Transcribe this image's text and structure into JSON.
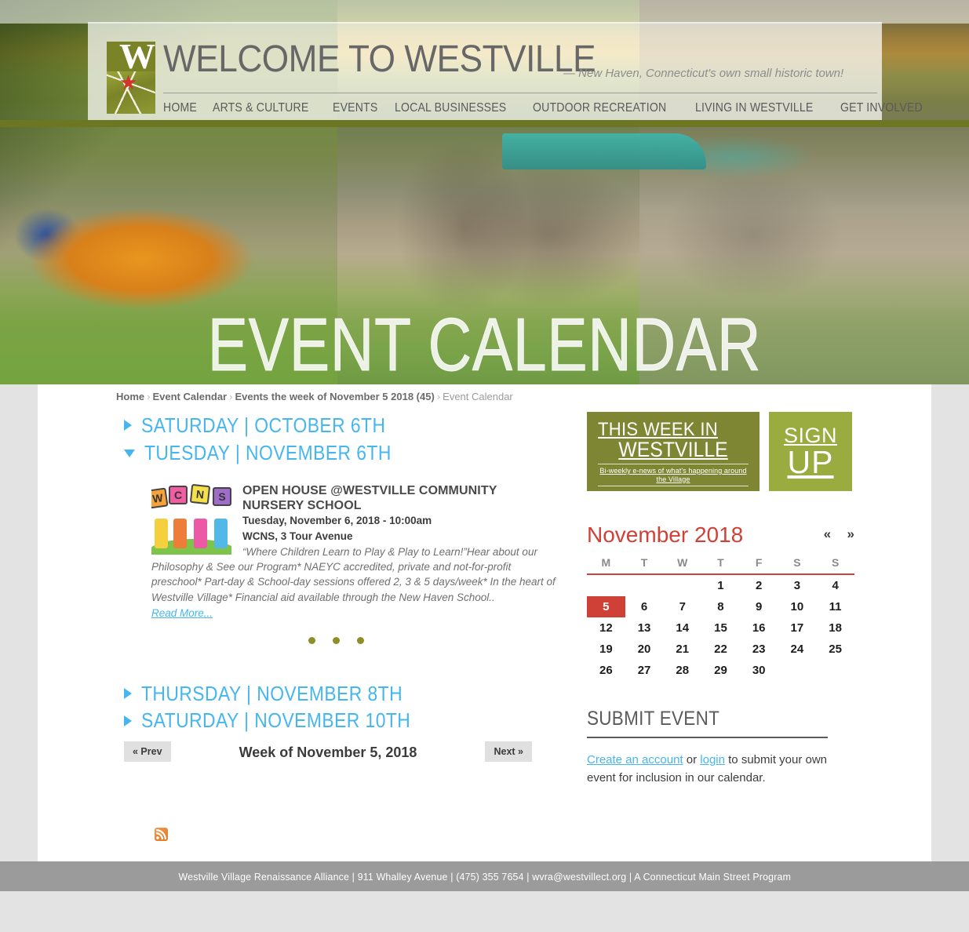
{
  "site": {
    "title": "WELCOME TO WESTVILLE",
    "tagline": "—  New Haven, Connecticut's own small historic town!",
    "logo_letter": "W"
  },
  "nav": {
    "items": [
      {
        "label": "HOME",
        "name": "home"
      },
      {
        "label": "ARTS & CULTURE",
        "name": "arts-culture"
      },
      {
        "label": "EVENTS",
        "name": "events"
      },
      {
        "label": "LOCAL BUSINESSES",
        "name": "local-businesses"
      },
      {
        "label": "OUTDOOR RECREATION",
        "name": "outdoor-recreation"
      },
      {
        "label": "LIVING IN WESTVILLE",
        "name": "living-in-westville"
      },
      {
        "label": "GET INVOLVED",
        "name": "get-involved"
      }
    ]
  },
  "hero": {
    "title": "EVENT CALENDAR"
  },
  "breadcrumb": {
    "home": "Home",
    "event_calendar": "Event Calendar",
    "week": "Events the week of November 5 2018 (45)",
    "current": "Event Calendar",
    "separator": "›"
  },
  "days": [
    {
      "label": "SATURDAY  |  OCTOBER 6TH",
      "expanded": false
    },
    {
      "label": "TUESDAY  |  NOVEMBER 6TH",
      "expanded": true
    },
    {
      "label": "THURSDAY  |  NOVEMBER 8TH",
      "expanded": false
    },
    {
      "label": "SATURDAY  |  NOVEMBER 10TH",
      "expanded": false
    }
  ],
  "event": {
    "title": "OPEN HOUSE @WESTVILLE COMMUNITY NURSERY SCHOOL",
    "when": "Tuesday, November 6, 2018 - 10:00am",
    "where": "WCNS, 3 Tour Avenue",
    "description": "“Where Children Learn to Play & Play to Learn!”Hear about our Philosophy & See our Program* NAEYC accredited, private and not-for-profit preschool* Part-day & School-day sessions offered 2, 3 & 5 days/week* In the heart of Westville Village* Financial aid available through the New Haven School..",
    "read_more": "Read More...",
    "thumbnail_letters": [
      "W",
      "C",
      "N",
      "S"
    ],
    "carousel_dots": 3
  },
  "week_nav": {
    "prev": "« Prev",
    "label": "Week of November 5, 2018",
    "next": "Next »"
  },
  "feed": {
    "icon": "rss-icon"
  },
  "promos": {
    "newsletter": {
      "line1": "THIS WEEK IN",
      "line2": "WESTVILLE",
      "subtitle": "Bi-weekly e-news of what's happening around the Village",
      "color": "#7e8533"
    },
    "signup": {
      "line1": "SIGN",
      "line2": "UP",
      "color": "#9aab40"
    }
  },
  "calendar": {
    "month": "November 2018",
    "prev": "«",
    "next": "»",
    "weekday_headers": [
      "M",
      "T",
      "W",
      "T",
      "F",
      "S",
      "S"
    ],
    "accent_color": "#cf4136",
    "today": 5,
    "weeks": [
      [
        "",
        "",
        "",
        "1",
        "2",
        "3",
        "4"
      ],
      [
        "5",
        "6",
        "7",
        "8",
        "9",
        "10",
        "11"
      ],
      [
        "12",
        "13",
        "14",
        "15",
        "16",
        "17",
        "18"
      ],
      [
        "19",
        "20",
        "21",
        "22",
        "23",
        "24",
        "25"
      ],
      [
        "26",
        "27",
        "28",
        "29",
        "30",
        "",
        ""
      ]
    ]
  },
  "submit_event": {
    "heading": "SUBMIT EVENT",
    "create_link": "Create an account",
    "or": " or ",
    "login_link": "login",
    "rest": " to submit your own event for inclusion in our calendar."
  },
  "footer": {
    "text": "Westville Village Renaissance Alliance  | 911 Whalley Avenue |  (475) 355 7654  |  wvra@westvillect.org  |  A Connecticut Main Street Program"
  }
}
